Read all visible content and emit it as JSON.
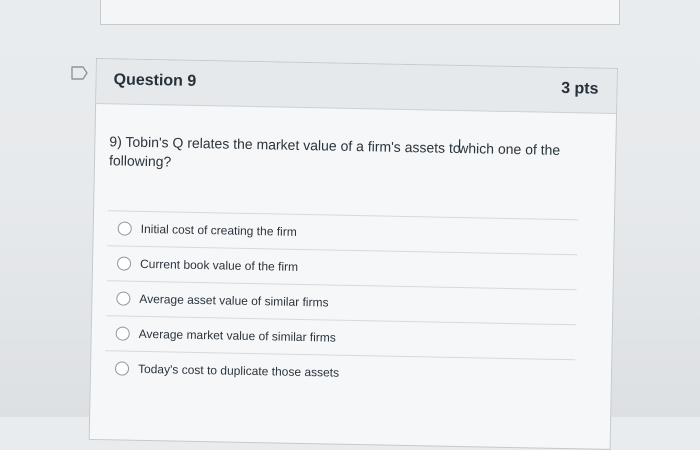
{
  "question": {
    "title": "Question 9",
    "points": "3 pts",
    "text_before_cursor": "9) Tobin's Q relates the market value of a firm's assets to",
    "text_after_cursor": "which one of the following?",
    "cursor_icon": "text-cursor-icon",
    "flag_icon": "flag-outline-icon"
  },
  "answers": [
    {
      "label": "Initial cost of creating the firm",
      "selected": false
    },
    {
      "label": "Current book value of the firm",
      "selected": false
    },
    {
      "label": "Average asset value of similar firms",
      "selected": false
    },
    {
      "label": "Average market value of similar firms",
      "selected": false
    },
    {
      "label": "Today's cost to duplicate those assets",
      "selected": false
    }
  ]
}
